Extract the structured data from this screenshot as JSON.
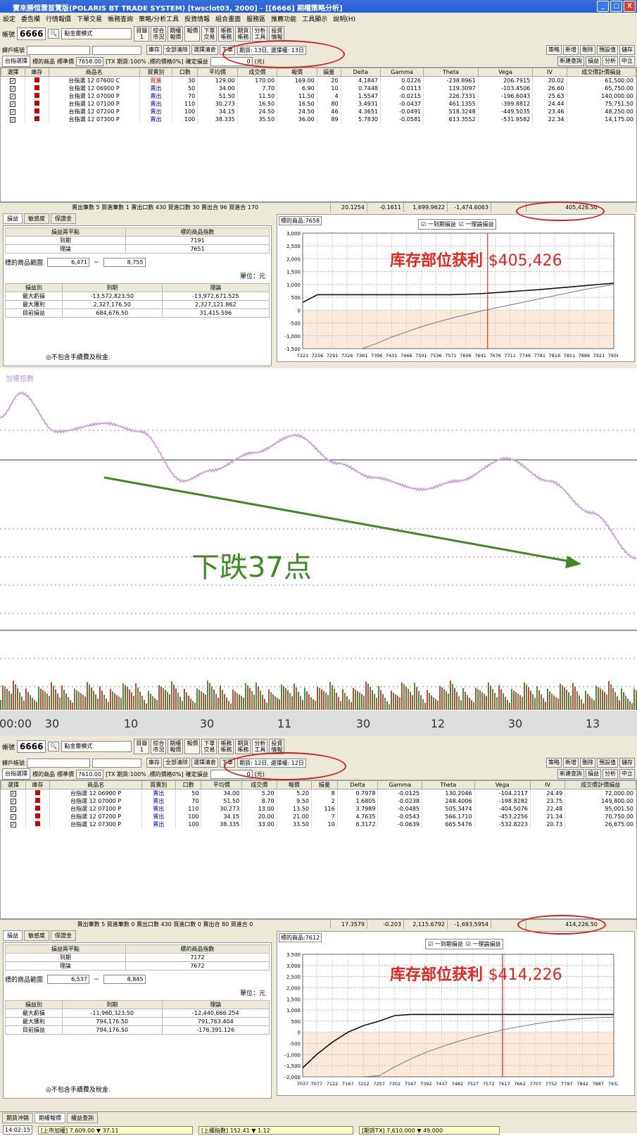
{
  "window": {
    "title": "寶來勝恒雲首覽版(POLARIS BT TRADE SYSTEM)  [twsclot03, 2000] - [[6666] 期權策略分析]",
    "btn_min": "_",
    "btn_max": "□",
    "btn_close": "X"
  },
  "menu": [
    "設定",
    "委告欄",
    "行情報價",
    "下單交易",
    "帳務查詢",
    "策略/分析工具",
    "投資情報",
    "組合畫面",
    "服務區",
    "推薦功能",
    "工具顯示",
    "說明(H)"
  ],
  "toolbar_common": {
    "account_label": "帳號",
    "mode": "點金靈模式",
    "buttons": [
      "目錄\n1",
      "綜合\n市況",
      "期權\n報價",
      "報價",
      "下單\n交易",
      "帳務\n帳務",
      "期貨\n帳務",
      "分析\n工具",
      "投資\n情報"
    ]
  },
  "panel1": {
    "account": "6666",
    "row2_left": "歸戶帳號",
    "row2_buttons": [
      "庫存",
      "全部清除",
      "選擇清倉",
      "下單"
    ],
    "expiry_box": "期貨: 13日, 選擇權: 13日",
    "right_buttons": [
      "策略",
      "新增",
      "刪除",
      "預設值",
      "儲存"
    ],
    "row3": {
      "product_sel": "台指選擇",
      "ul_label": "標的商品",
      "ul_price_label": "標準價",
      "ul_price": "7658.00",
      "margin_text": "[TX 期貨:100% ,標的價格0%]",
      "confirm_label": "確定損益",
      "confirm_val": "0",
      "unit": "(元)",
      "right_buttons": [
        "新建查詢",
        "損益",
        "分析",
        "中立"
      ]
    },
    "columns": [
      "選擇",
      "庫存",
      "商品名",
      "買賣別",
      "口數",
      "平均價",
      "成交價",
      "報價",
      "損量",
      "Delta",
      "Gamma",
      "Theta",
      "Vega",
      "IV",
      "成交價計價損益"
    ],
    "rows": [
      {
        "name": "台指選 12 07600 C",
        "side": "買進",
        "qty": "30",
        "avg": "129.00",
        "last": "170.00",
        "quote": "169.00",
        "vol": "20",
        "delta": "4.1847",
        "gamma": "0.0226",
        "theta": "-238.8961",
        "vega": "206.7915",
        "iv": "20.02",
        "pnl": "61,500.00"
      },
      {
        "name": "台指選 12 06900 P",
        "side": "賣出",
        "qty": "50",
        "avg": "34.00",
        "last": "7.70",
        "quote": "6.90",
        "vol": "10",
        "delta": "0.7448",
        "gamma": "-0.0113",
        "theta": "119.3097",
        "vega": "-103.4506",
        "iv": "26.60",
        "pnl": "65,750.00"
      },
      {
        "name": "台指選 12 07000 P",
        "side": "賣出",
        "qty": "70",
        "avg": "51.50",
        "last": "11.50",
        "quote": "11.50",
        "vol": "4",
        "delta": "1.5547",
        "gamma": "-0.0215",
        "theta": "226.7331",
        "vega": "-196.6043",
        "iv": "25.63",
        "pnl": "140,000.00"
      },
      {
        "name": "台指選 12 07100 P",
        "side": "賣出",
        "qty": "110",
        "avg": "30.273",
        "last": "16.50",
        "quote": "16.50",
        "vol": "80",
        "delta": "3.4931",
        "gamma": "-0.0437",
        "theta": "461.1355",
        "vega": "-399.8812",
        "iv": "24.44",
        "pnl": "75,751.50"
      },
      {
        "name": "台指選 12 07200 P",
        "side": "賣出",
        "qty": "100",
        "avg": "34.15",
        "last": "24.50",
        "quote": "24.50",
        "vol": "46",
        "delta": "4.3651",
        "gamma": "-0.0491",
        "theta": "518.3248",
        "vega": "-449.5035",
        "iv": "23.46",
        "pnl": "48,250.00"
      },
      {
        "name": "台指選 12 07300 P",
        "side": "賣出",
        "qty": "100",
        "avg": "38.335",
        "last": "35.50",
        "quote": "36.00",
        "vol": "89",
        "delta": "5.7830",
        "gamma": "-0.0581",
        "theta": "613.3552",
        "vega": "-531.9582",
        "iv": "22.34",
        "pnl": "14,175.00"
      }
    ],
    "summary": {
      "text": "賣出筆數 5 買進筆數 1 賣出口數 430 買進口數 30 賣出合 96 買進合 170",
      "delta": "20.1254",
      "gamma": "-0.1611",
      "theta": "1,699.9622",
      "vega": "-1,474.6063",
      "pnl": "405,426.50"
    },
    "tabs": [
      "損益",
      "敏感度",
      "保證金"
    ],
    "be_header": [
      "損益兩平點",
      "標的商品指數"
    ],
    "be_rows": [
      [
        "到期",
        "7191"
      ],
      [
        "理論",
        "7651"
      ]
    ],
    "range_label": "標的商品範圍",
    "range_from": "6,471",
    "range_to": "8,755",
    "unit_label": "單位：元",
    "pl_header": [
      "損益別",
      "到期",
      "理論"
    ],
    "pl_rows": [
      [
        "最大虧損",
        "-13,572,823.50",
        "-13,972,671.525"
      ],
      [
        "最大獲利",
        "2,327,176.50",
        "2,327,121.862"
      ],
      [
        "目前損益",
        "684,676.50",
        "31,415.596"
      ]
    ],
    "footnote": "◎不包含手續費及稅金.",
    "chart_label": "標的商品:7658",
    "legend1": "一到期損益",
    "legend2": "一理論損益",
    "annotation_cn": "库存部位获利",
    "annotation_num": "$405,426"
  },
  "intraday": {
    "title": "加權指數",
    "annotation": "下跌37点",
    "time_labels": [
      "00:00",
      "30",
      "10",
      "30",
      "11",
      "30",
      "12",
      "30",
      "13"
    ]
  },
  "panel2": {
    "account": "6666",
    "expiry_box": "期貨: 12日, 選擇權: 12日",
    "row3": {
      "ul_price": "7610.00",
      "margin_text": "[TX 期貨:100% ,標的價格0%]",
      "confirm_val": "0"
    },
    "rows": [
      {
        "name": "台指選 12 06900 P",
        "side": "賣出",
        "qty": "50",
        "avg": "34.00",
        "last": "5.20",
        "quote": "5.20",
        "vol": "8",
        "delta": "0.7978",
        "gamma": "-0.0125",
        "theta": "130.2046",
        "vega": "-104.2117",
        "iv": "24.49",
        "pnl": "72,000.00"
      },
      {
        "name": "台指選 12 07000 P",
        "side": "賣出",
        "qty": "70",
        "avg": "51.50",
        "last": "8.70",
        "quote": "9.50",
        "vol": "2",
        "delta": "1.6805",
        "gamma": "-0.0238",
        "theta": "248.4006",
        "vega": "-198.8282",
        "iv": "23.75",
        "pnl": "149,800.00"
      },
      {
        "name": "台指選 12 07100 P",
        "side": "賣出",
        "qty": "110",
        "avg": "30.273",
        "last": "13.00",
        "quote": "13.50",
        "vol": "116",
        "delta": "3.7989",
        "gamma": "-0.0485",
        "theta": "505.3474",
        "vega": "-404.5076",
        "iv": "22.48",
        "pnl": "95,001.50"
      },
      {
        "name": "台指選 12 07200 P",
        "side": "賣出",
        "qty": "100",
        "avg": "34.15",
        "last": "20.00",
        "quote": "21.00",
        "vol": "7",
        "delta": "4.7635",
        "gamma": "-0.0543",
        "theta": "566.1710",
        "vega": "-453.2256",
        "iv": "21.34",
        "pnl": "70,750.00"
      },
      {
        "name": "台指選 12 07300 P",
        "side": "賣出",
        "qty": "100",
        "avg": "38.335",
        "last": "33.00",
        "quote": "33.50",
        "vol": "10",
        "delta": "6.3172",
        "gamma": "-0.0639",
        "theta": "665.5476",
        "vega": "-532.8223",
        "iv": "20.73",
        "pnl": "26,675.00"
      }
    ],
    "summary": {
      "text": "賣出筆數 5 買進筆數 0 賣出口數 430 買進口數 0 賣出合 80 買進合 0",
      "delta": "17.3579",
      "gamma": "-0.203",
      "theta": "2,115.6792",
      "vega": "-1,693.5954",
      "pnl": "414,226.50"
    },
    "be_rows": [
      [
        "到期",
        "7172"
      ],
      [
        "理論",
        "7672"
      ]
    ],
    "range_from": "6,537",
    "range_to": "8,845",
    "pl_rows": [
      [
        "最大虧損",
        "-11,960,323.50",
        "-12,440,666.254"
      ],
      [
        "最大獲利",
        "794,176.50",
        "791,763.404"
      ],
      [
        "目前損益",
        "794,176.50",
        "-176,391.126"
      ]
    ],
    "chart_label": "標的商品:7612",
    "annotation_num": "$414,226"
  },
  "statusbar": {
    "tabs": [
      "期貨沖銷",
      "期權報價",
      "權益查詢"
    ],
    "time": "14:02:15",
    "quote1": "[上市加權] 7,609.00 ▼ 37.11",
    "quote2": "[上櫃指數] 152.41 ▼ 1.12",
    "quote3": "[期貨TX] 7,610.000 ▼ 49.000"
  },
  "chart_data": [
    {
      "type": "line",
      "title": "",
      "x": [
        7221,
        7256,
        7291,
        7326,
        7361,
        7396,
        7431,
        7466,
        7501,
        7536,
        7571,
        7606,
        7641,
        7676,
        7711,
        7746,
        7781,
        7816,
        7851,
        7886,
        7921,
        7956
      ],
      "series": [
        {
          "name": "到期損益",
          "values": [
            300,
            600,
            600,
            600,
            600,
            600,
            600,
            600,
            600,
            600,
            600,
            620,
            640,
            680,
            720,
            760,
            800,
            850,
            900,
            950,
            1000,
            1050
          ]
        },
        {
          "name": "理論損益",
          "values": [
            -3000,
            -2600,
            -2200,
            -1850,
            -1550,
            -1300,
            -1050,
            -850,
            -650,
            -480,
            -320,
            -180,
            -40,
            80,
            200,
            320,
            440,
            560,
            680,
            800,
            900,
            1000
          ]
        }
      ],
      "ylim": [
        -1500,
        3000
      ]
    },
    {
      "type": "line",
      "title": "",
      "x": [
        7037,
        7077,
        7122,
        7167,
        7212,
        7257,
        7302,
        7347,
        7392,
        7437,
        7482,
        7527,
        7572,
        7617,
        7662,
        7707,
        7752,
        7797,
        7842,
        7887,
        7932
      ],
      "series": [
        {
          "name": "到期損益",
          "values": [
            -1600,
            -1000,
            -450,
            0,
            300,
            500,
            750,
            800,
            800,
            800,
            800,
            800,
            800,
            800,
            800,
            800,
            800,
            800,
            800,
            800,
            800
          ]
        },
        {
          "name": "理論損益",
          "values": [
            -5000,
            -4200,
            -3500,
            -2900,
            -2400,
            -1950,
            -1550,
            -1200,
            -900,
            -650,
            -420,
            -220,
            -40,
            120,
            260,
            380,
            480,
            560,
            620,
            660,
            680
          ]
        }
      ],
      "ylim": [
        -2000,
        3500
      ]
    }
  ]
}
